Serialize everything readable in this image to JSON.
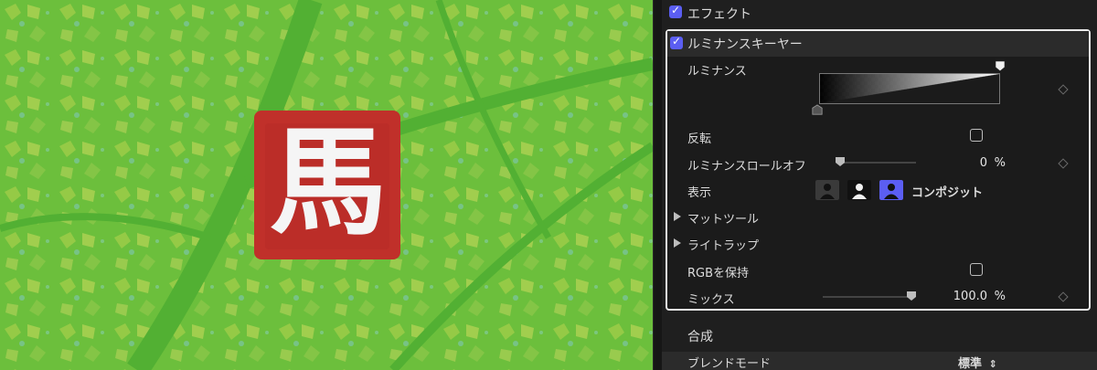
{
  "viewer": {
    "seal_glyph": "馬"
  },
  "inspector": {
    "effects_header": {
      "label": "エフェクト",
      "checked": true
    },
    "keyer": {
      "title": "ルミナンスキーヤー",
      "enabled": true,
      "luminance_label": "ルミナンス",
      "invert_label": "反転",
      "invert_checked": false,
      "rolloff_label": "ルミナンスロールオフ",
      "rolloff_value": "0",
      "rolloff_unit": "%",
      "rolloff_level": 0,
      "view_label": "表示",
      "view_mode": "コンポジット",
      "matte_tools_label": "マットツール",
      "light_wrap_label": "ライトラップ",
      "preserve_rgb_label": "RGBを保持",
      "preserve_rgb_checked": false,
      "mix_label": "ミックス",
      "mix_value": "100.0",
      "mix_unit": "%",
      "mix_level": 1.0
    },
    "compositing": {
      "title": "合成",
      "blend_mode_label": "ブレンドモード",
      "blend_mode_value": "標準"
    }
  },
  "colors": {
    "accent": "#5b5ef2",
    "seal_red": "#c0302a",
    "foliage": "#5fb83a"
  }
}
